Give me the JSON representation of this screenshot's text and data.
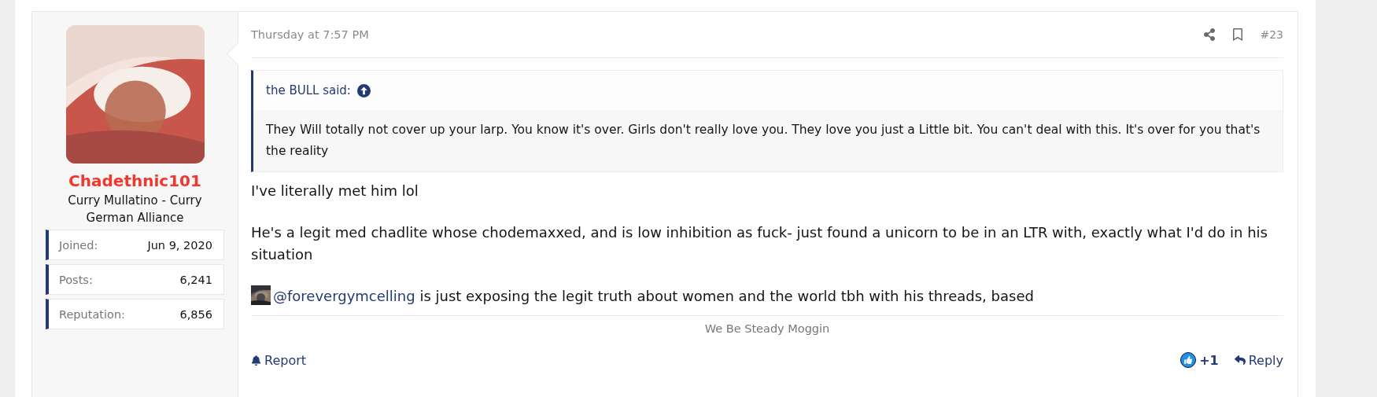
{
  "user": {
    "name": "Chadethnic101",
    "title": "Curry Mullatino - Curry German Alliance",
    "stats": [
      {
        "label": "Joined:",
        "value": "Jun 9, 2020"
      },
      {
        "label": "Posts:",
        "value": "6,241"
      },
      {
        "label": "Reputation:",
        "value": "6,856"
      }
    ]
  },
  "post": {
    "timestamp": "Thursday at 7:57 PM",
    "number": "#23",
    "quote": {
      "author": "the BULL said:",
      "text": "They Will totally not cover up your larp. You know it's over. Girls don't really love you. They love you just a Little bit. You can't deal with this. It's over for you that's the reality"
    },
    "paragraphs": [
      {
        "kind": "text",
        "text": "I've literally met him lol"
      },
      {
        "kind": "text",
        "text": "He's a legit med chadlite whose chodemaxxed, and is low inhibition as fuck- just found a unicorn to be in an LTR with, exactly what I'd do in his situation"
      },
      {
        "kind": "mention",
        "mention": "@forevergymcelling",
        "text": " is just exposing the legit truth about women and the world tbh with his threads, based"
      }
    ],
    "signature": "We Be Steady Moggin",
    "actions": {
      "report": "Report",
      "reaction_count": "+1",
      "reply": "Reply"
    }
  }
}
